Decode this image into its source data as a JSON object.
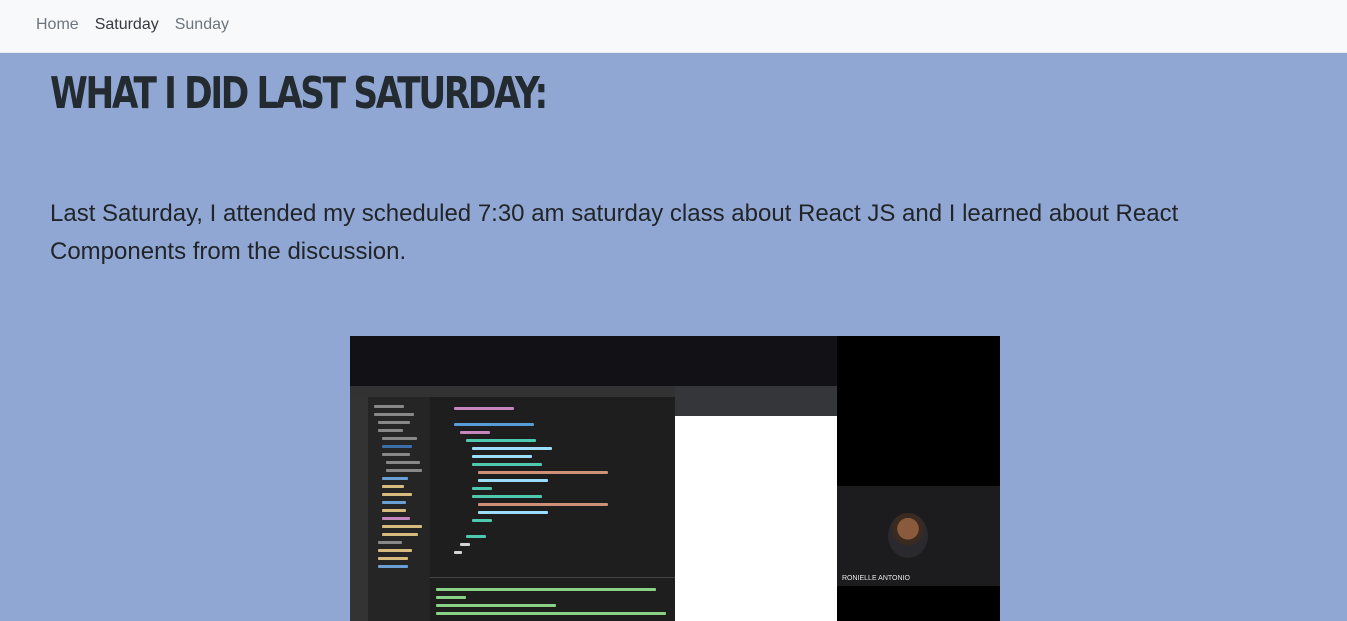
{
  "nav": {
    "items": [
      {
        "label": "Home"
      },
      {
        "label": "Saturday"
      },
      {
        "label": "Sunday"
      }
    ],
    "active_index": 1
  },
  "main": {
    "heading": "What I did last Saturday:",
    "paragraph": "Last Saturday, I attended my scheduled 7:30 am saturday class about React JS and I learned about React Components from the discussion."
  },
  "video": {
    "participant_name": "RONIELLE ANTONIO"
  },
  "colors": {
    "page_background": "#91a7d3",
    "navbar_background": "#f8f9fa",
    "text": "#212529"
  }
}
